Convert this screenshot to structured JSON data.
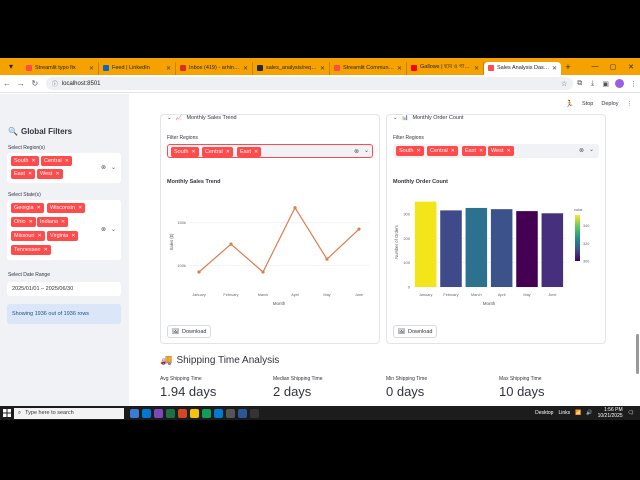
{
  "browser": {
    "tabs": [
      {
        "label": "Streamlit typo fix",
        "color": "#ff4b4b",
        "active": false
      },
      {
        "label": "Feed | LinkedIn",
        "color": "#0a66c2",
        "active": false
      },
      {
        "label": "Inbox (419) - arhinaeroi@...",
        "color": "#d93025",
        "active": false
      },
      {
        "label": "sales_analysis/requirement...",
        "color": "#24292f",
        "active": false
      },
      {
        "label": "Streamlit Community Clou...",
        "color": "#ff4b4b",
        "active": false
      },
      {
        "label": "Gallows | ছবি ও গান...",
        "color": "#ff0000",
        "active": false
      },
      {
        "label": "Sales Analysis Dashboard",
        "color": "#ff4b4b",
        "active": true
      }
    ],
    "url": "localhost:8501"
  },
  "app": {
    "stop_label": "Stop",
    "deploy_label": "Deploy"
  },
  "sidebar": {
    "title": "Global Filters",
    "region_label": "Select Region(s)",
    "regions": [
      "South",
      "Central",
      "East",
      "West"
    ],
    "state_label": "Select State(s)",
    "states": [
      "Georgia",
      "Wisconsin",
      "Ohio",
      "Indiana",
      "Missouri",
      "Virginia",
      "Tennessee"
    ],
    "date_label": "Select Date Range",
    "date_value": "2025/01/01 – 2025/06/30",
    "info_text": "Showing 1936 out of 1936 rows"
  },
  "sales_card": {
    "header": "Monthly Sales Trend",
    "filter_label": "Filter Regions",
    "chips": [
      "South",
      "Central",
      "East"
    ],
    "chart_title": "Monthly Sales Trend",
    "download_label": "Download"
  },
  "orders_card": {
    "header": "Monthly Order Count",
    "filter_label": "Filter Regions",
    "chips": [
      "South",
      "Central",
      "East",
      "West"
    ],
    "chart_title": "Monthly Order Count",
    "download_label": "Download"
  },
  "chart_data": [
    {
      "type": "line",
      "title": "Monthly Sales Trend",
      "xlabel": "Month",
      "ylabel": "Sales ($)",
      "categories": [
        "January",
        "February",
        "March",
        "April",
        "May",
        "June"
      ],
      "values": [
        70000,
        200000,
        70000,
        370000,
        130000,
        270000
      ],
      "yticks": [
        {
          "value": 100000,
          "label": "100k"
        },
        {
          "value": 300000,
          "label": "150k"
        }
      ],
      "ylim": [
        0,
        420000
      ],
      "color": "#e07b4a"
    },
    {
      "type": "bar",
      "title": "Monthly Order Count",
      "xlabel": "Month",
      "ylabel": "Number of Orders",
      "categories": [
        "January",
        "February",
        "March",
        "April",
        "May",
        "June"
      ],
      "values": [
        351,
        315,
        325,
        320,
        312,
        303
      ],
      "colors": [
        "#f2e61b",
        "#3e4a89",
        "#2c728e",
        "#3b528b",
        "#440154",
        "#46307e"
      ],
      "yticks": [
        0,
        100,
        200,
        300
      ],
      "ylim": [
        0,
        370
      ],
      "colorbar": {
        "label": "color",
        "ticks": [
          300,
          320,
          340
        ]
      }
    }
  ],
  "shipping": {
    "title": "Shipping Time Analysis",
    "metrics": [
      {
        "label": "Avg Shipping Time",
        "value": "1.94 days"
      },
      {
        "label": "Median Shipping Time",
        "value": "2 days"
      },
      {
        "label": "Min Shipping Time",
        "value": "0 days"
      },
      {
        "label": "Max Shipping Time",
        "value": "10 days"
      }
    ]
  },
  "taskbar": {
    "search_placeholder": "Type here to search",
    "desktop_label": "Desktop",
    "links_label": "Links",
    "time": "1:56 PM",
    "date": "10/21/2025"
  }
}
